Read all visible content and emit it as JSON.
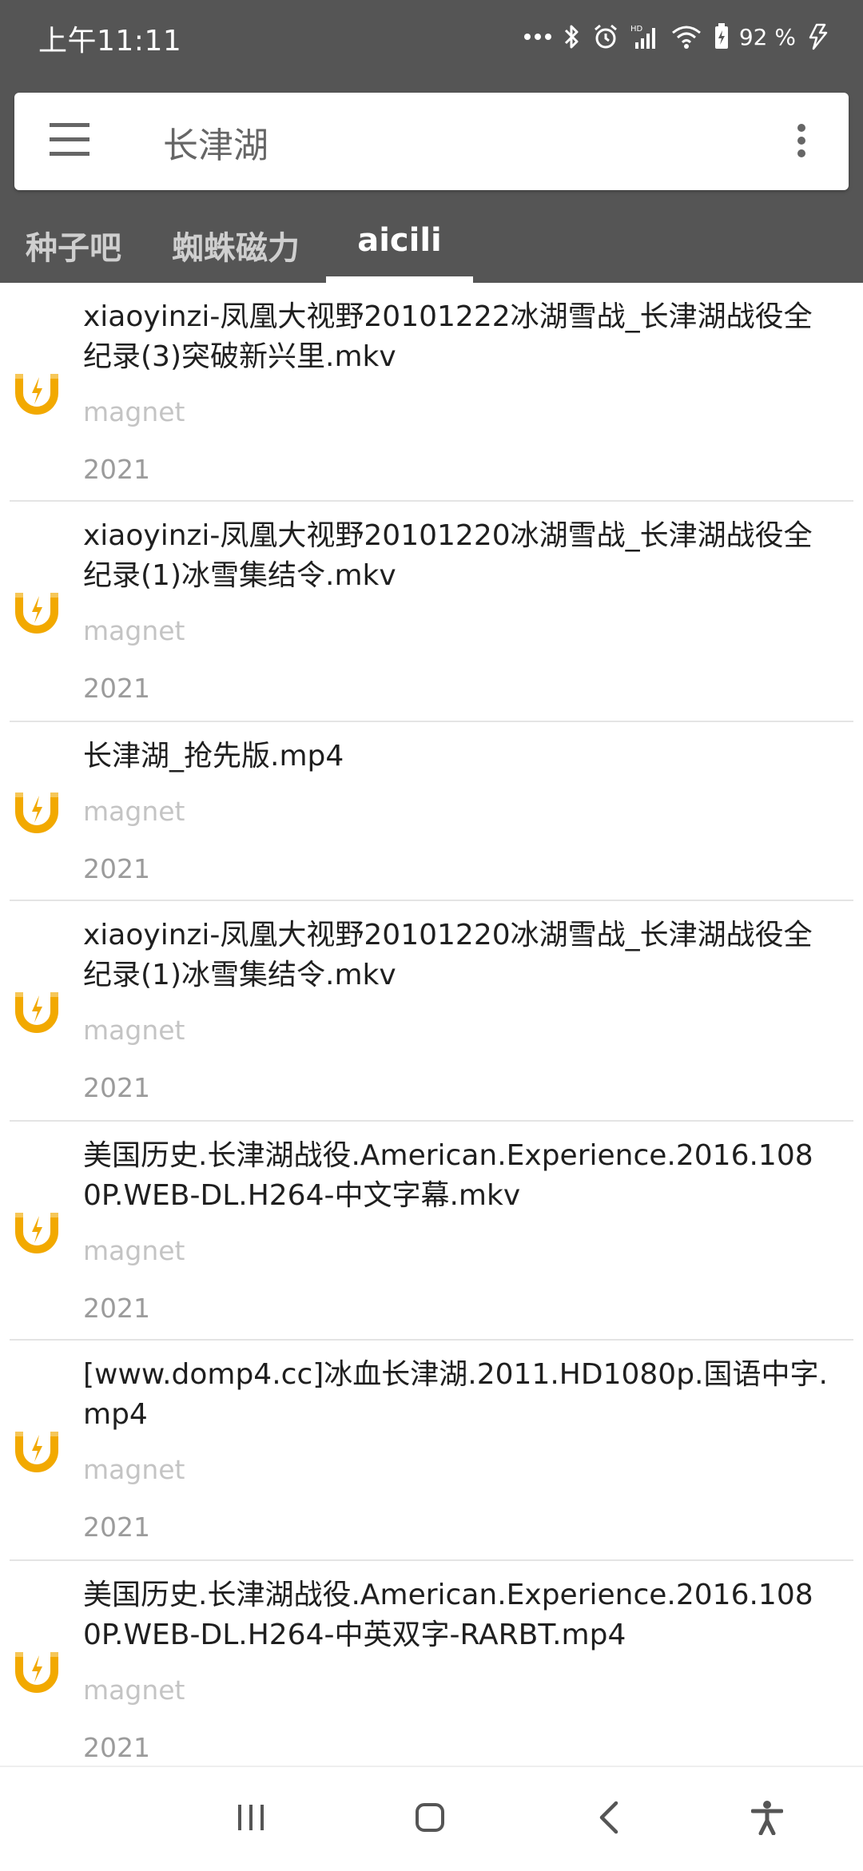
{
  "status": {
    "time": "上午11:11",
    "battery": "92 %"
  },
  "search": {
    "query": "长津湖"
  },
  "tabs": [
    {
      "label": "种子吧"
    },
    {
      "label": "蜘蛛磁力"
    },
    {
      "label": "aicili"
    }
  ],
  "results": [
    {
      "title": "xiaoyinzi-凤凰大视野20101222冰湖雪战_长津湖战役全纪录(3)突破新兴里.mkv",
      "type": "magnet",
      "year": "2021"
    },
    {
      "title": "xiaoyinzi-凤凰大视野20101220冰湖雪战_长津湖战役全纪录(1)冰雪集结令.mkv",
      "type": "magnet",
      "year": "2021"
    },
    {
      "title": "长津湖_抢先版.mp4",
      "type": "magnet",
      "year": "2021"
    },
    {
      "title": "xiaoyinzi-凤凰大视野20101220冰湖雪战_长津湖战役全纪录(1)冰雪集结令.mkv",
      "type": "magnet",
      "year": "2021"
    },
    {
      "title": "美国历史.长津湖战役.American.Experience.2016.1080P.WEB-DL.H264-中文字幕.mkv",
      "type": "magnet",
      "year": "2021"
    },
    {
      "title": "[www.domp4.cc]冰血长津湖.2011.HD1080p.国语中字.mp4",
      "type": "magnet",
      "year": "2021"
    },
    {
      "title": "美国历史.长津湖战役.American.Experience.2016.1080P.WEB-DL.H264-中英双字-RARBT.mp4",
      "type": "magnet",
      "year": "2021"
    }
  ],
  "icons": {
    "menu": "hamburger-menu-icon",
    "overflow": "more-vert-icon",
    "result": "magnet-icon",
    "nav_recents": "recents-icon",
    "nav_home": "home-icon",
    "nav_back": "back-icon",
    "nav_accessibility": "accessibility-icon"
  },
  "colors": {
    "top_band": "#555555",
    "magnet": "#F2A900",
    "meta_light": "#C4C4C4",
    "meta_year": "#9B9B9B"
  }
}
